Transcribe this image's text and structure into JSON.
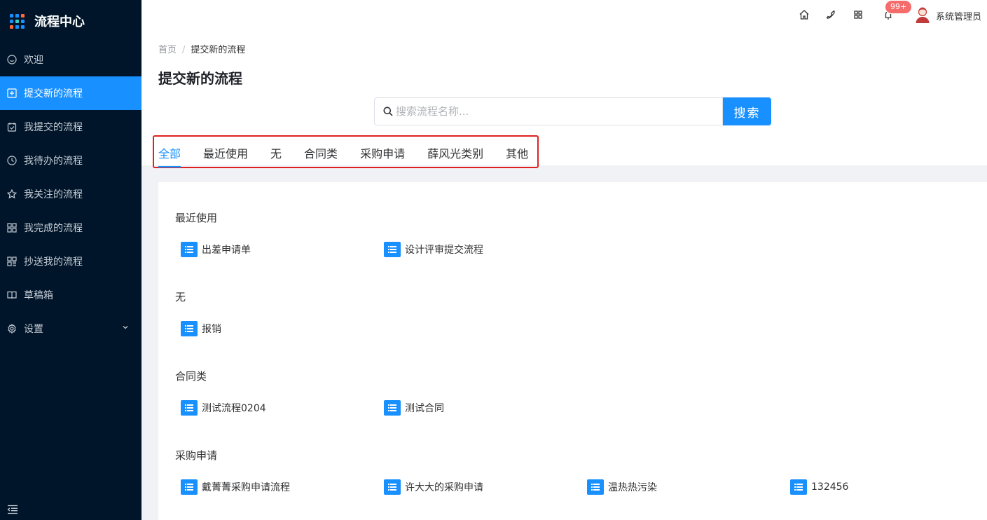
{
  "app": {
    "title": "流程中心"
  },
  "sidebar": {
    "items": [
      {
        "label": "欢迎",
        "icon": "smile-icon"
      },
      {
        "label": "提交新的流程",
        "icon": "plus-square-icon",
        "active": true
      },
      {
        "label": "我提交的流程",
        "icon": "calendar-check-icon"
      },
      {
        "label": "我待办的流程",
        "icon": "clock-icon"
      },
      {
        "label": "我关注的流程",
        "icon": "star-icon"
      },
      {
        "label": "我完成的流程",
        "icon": "grid-icon"
      },
      {
        "label": "抄送我的流程",
        "icon": "apps-icon"
      },
      {
        "label": "草稿箱",
        "icon": "book-icon"
      },
      {
        "label": "设置",
        "icon": "gear-icon"
      }
    ]
  },
  "header": {
    "badge": "99+",
    "username": "系统管理员",
    "icons": [
      "home-icon",
      "phone-icon",
      "apps-icon",
      "bell-icon"
    ]
  },
  "breadcrumb": {
    "home": "首页",
    "current": "提交新的流程"
  },
  "page": {
    "title": "提交新的流程"
  },
  "search": {
    "placeholder": "搜索流程名称...",
    "button": "搜索"
  },
  "tabs": [
    "全部",
    "最近使用",
    "无",
    "合同类",
    "采购申请",
    "薛风光类别",
    "其他"
  ],
  "groups": [
    {
      "title": "最近使用",
      "items": [
        "出差申请单",
        "设计评审提交流程"
      ]
    },
    {
      "title": "无",
      "items": [
        "报销"
      ]
    },
    {
      "title": "合同类",
      "items": [
        "测试流程0204",
        "测试合同"
      ]
    },
    {
      "title": "采购申请",
      "items": [
        "戴菁菁采购申请流程",
        "许大大的采购申请",
        "温热热污染",
        "132456"
      ]
    }
  ],
  "colors": {
    "accent": "#1890ff",
    "sidebar": "#001529",
    "highlight": "#e02020",
    "badge": "#f56c6c"
  }
}
